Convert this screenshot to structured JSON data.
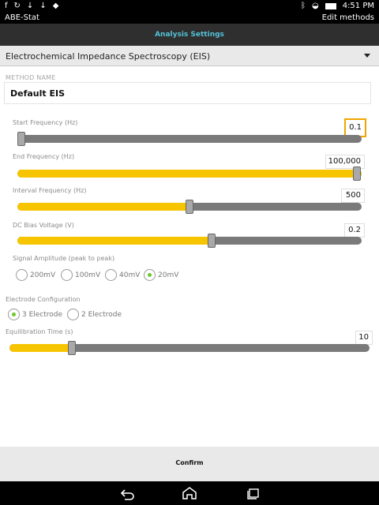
{
  "status": {
    "time": "4:51 PM",
    "left_icons": [
      "facebook-icon",
      "sync-icon",
      "download-icon",
      "download-icon",
      "android-icon"
    ],
    "right_icons": [
      "bluetooth-icon",
      "wifi-icon",
      "battery-icon"
    ]
  },
  "app": {
    "title": "ABE-Stat",
    "edit_methods": "Edit methods",
    "header": "Analysis Settings"
  },
  "spinner": {
    "selected": "Electrochemical Impedance Spectroscopy (EIS)"
  },
  "method": {
    "label": "METHOD NAME",
    "value": "Default EIS"
  },
  "sliders": {
    "start_frequency": {
      "label": "Start Frequency (Hz)",
      "value": "0.1",
      "fraction": 0.0
    },
    "end_frequency": {
      "label": "End Frequency (Hz)",
      "value": "100,000",
      "fraction": 1.0
    },
    "interval_frequency": {
      "label": "Interval Frequency (Hz)",
      "value": "500",
      "fraction": 0.5
    },
    "dc_bias_voltage": {
      "label": "DC Bias Voltage (V)",
      "value": "0.2",
      "fraction": 0.57
    },
    "equilibration_time": {
      "label": "Equilibration Time (s)",
      "value": "10",
      "fraction": 0.17
    }
  },
  "signal_amplitude": {
    "label": "Signal Amplitude (peak to peak)",
    "options": [
      "200mV",
      "100mV",
      "40mV",
      "20mV"
    ],
    "selected": "20mV"
  },
  "electrode_configuration": {
    "label": "Electrode Configuration",
    "options": [
      "3 Electrode",
      "2 Electrode"
    ],
    "selected": "3 Electrode"
  },
  "footer": {
    "confirm": "Confirm"
  },
  "nav": {
    "icons": [
      "back-icon",
      "home-icon",
      "recents-icon"
    ]
  },
  "colors": {
    "accent": "#f7c400",
    "header_text": "#53c2d8",
    "radio_checked": "#6cc92e"
  }
}
